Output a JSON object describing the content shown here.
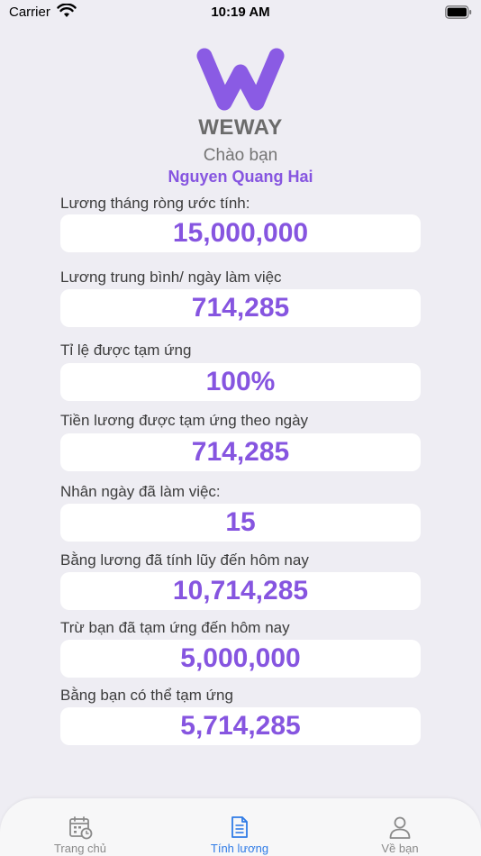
{
  "status_bar": {
    "carrier": "Carrier",
    "time": "10:19 AM"
  },
  "header": {
    "brand": "WEWAY",
    "greeting": "Chào bạn",
    "user_name": "Nguyen Quang Hai"
  },
  "rows": [
    {
      "label": "Lương tháng ròng ước tính:",
      "value": "15,000,000"
    },
    {
      "label": "Lương trung bình/ ngày làm việc",
      "value": "714,285"
    },
    {
      "label": "Tỉ lệ được tạm ứng",
      "value": "100%"
    },
    {
      "label": "Tiền lương được tạm ứng theo ngày",
      "value": "714,285"
    },
    {
      "label": "Nhân ngày đã làm việc:",
      "value": "15"
    },
    {
      "label": "Bằng lương đã tính lũy đến hôm nay",
      "value": "10,714,285"
    },
    {
      "label": "Trừ bạn đã tạm ứng đến hôm nay",
      "value": "5,000,000"
    },
    {
      "label": "Bằng bạn có thể tạm ứng",
      "value": "5,714,285"
    }
  ],
  "tabs": [
    {
      "label": "Trang chủ",
      "icon": "calendar-clock-icon",
      "active": false
    },
    {
      "label": "Tính lương",
      "icon": "document-icon",
      "active": true
    },
    {
      "label": "Về bạn",
      "icon": "user-icon",
      "active": false
    }
  ],
  "colors": {
    "accent": "#8655e0",
    "tab_active": "#2f7be6",
    "tab_inactive": "#8a8a8a",
    "background": "#eeedf3"
  }
}
